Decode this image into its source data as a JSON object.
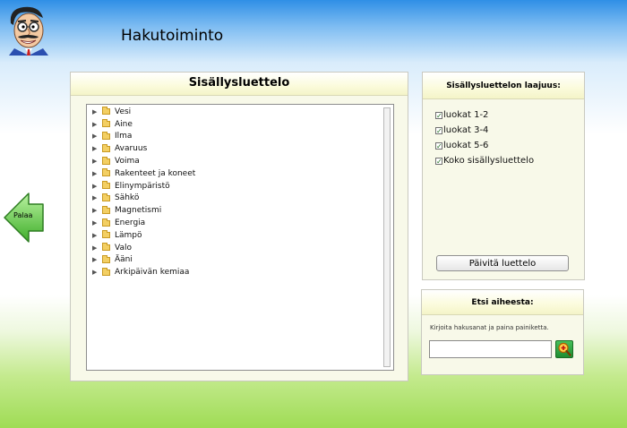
{
  "header": {
    "title": "Hakutoiminto"
  },
  "nav": {
    "back_label": "Palaa"
  },
  "toc": {
    "title": "Sisällysluettelo",
    "items": [
      {
        "label": "Vesi"
      },
      {
        "label": "Aine"
      },
      {
        "label": "Ilma"
      },
      {
        "label": "Avaruus"
      },
      {
        "label": "Voima"
      },
      {
        "label": "Rakenteet ja koneet"
      },
      {
        "label": "Elinympäristö"
      },
      {
        "label": "Sähkö"
      },
      {
        "label": "Magnetismi"
      },
      {
        "label": "Energia"
      },
      {
        "label": "Lämpö"
      },
      {
        "label": "Valo"
      },
      {
        "label": "Ääni"
      },
      {
        "label": "Arkipäivän kemiaa"
      }
    ]
  },
  "scope": {
    "title": "Sisällysluettelon laajuus:",
    "options": [
      {
        "label": "luokat 1-2",
        "checked": true
      },
      {
        "label": "luokat 3-4",
        "checked": true
      },
      {
        "label": "luokat 5-6",
        "checked": true
      },
      {
        "label": "Koko sisällysluettelo",
        "checked": true
      }
    ],
    "update_button": "Päivitä luettelo"
  },
  "search": {
    "title": "Etsi aiheesta:",
    "hint": "Kirjoita hakusanat ja paina painiketta.",
    "value": ""
  },
  "colors": {
    "accent_green": "#5cc23b",
    "panel_bg": "#f8f9e9"
  },
  "icons": {
    "logo": "cartoon-man-logo",
    "back": "green-left-arrow-icon",
    "folder": "folder-icon",
    "search": "magnifier-plus-icon"
  }
}
